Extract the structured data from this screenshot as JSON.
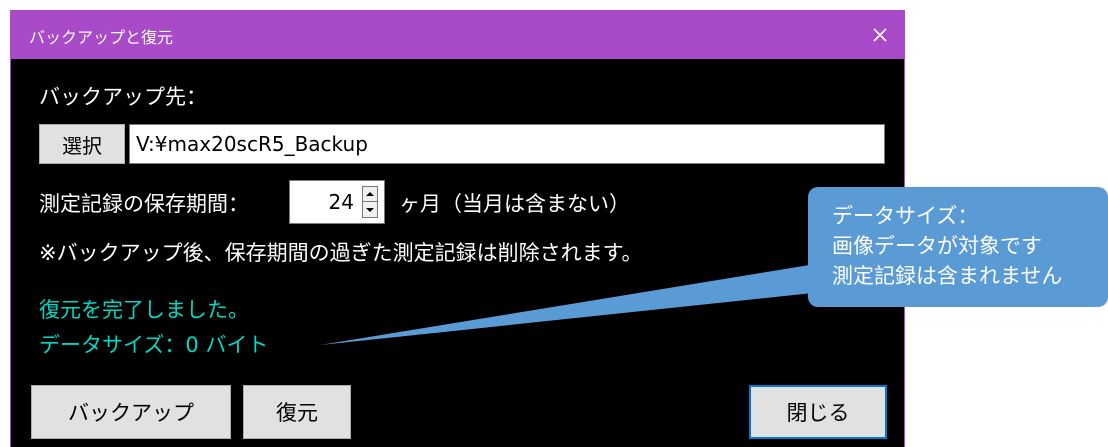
{
  "window": {
    "title": "バックアップと復元",
    "close_glyph": "✕"
  },
  "backup_dest": {
    "label": "バックアップ先：",
    "select_button": "選択",
    "path_value": "V:¥max20scR5_Backup"
  },
  "retention": {
    "label": "測定記録の保存期間：",
    "value": "24",
    "unit_text": "ヶ月（当月は含まない）",
    "note": "※バックアップ後、保存期間の過ぎた測定記録は削除されます。"
  },
  "status": {
    "line1": "復元を完了しました。",
    "line2": "データサイズ：0 バイト"
  },
  "buttons": {
    "backup": "バックアップ",
    "restore": "復元",
    "close": "閉じる"
  },
  "callout": {
    "line1": "データサイズ：",
    "line2": "画像データが対象です",
    "line3": "測定記録は含まれません"
  },
  "colors": {
    "titlebar": "#a94bc8",
    "status_text": "#00d9c5",
    "callout": "#5b9bd5",
    "default_button_border": "#0078d7"
  }
}
